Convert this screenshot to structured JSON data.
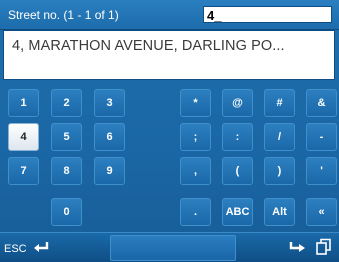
{
  "header": {
    "field_label": "Street no.  (1 - 1 of 1)",
    "input_value": "4_"
  },
  "result": {
    "text": "4, MARATHON AVENUE, DARLING PO..."
  },
  "keys": {
    "k1": "1",
    "k2": "2",
    "k3": "3",
    "k4": "4",
    "k5": "5",
    "k6": "6",
    "k7": "7",
    "k8": "8",
    "k9": "9",
    "k0": "0",
    "asterisk": "*",
    "at": "@",
    "hash": "#",
    "amp": "&",
    "semicolon": ";",
    "colon": ":",
    "slash": "/",
    "dash": "-",
    "comma": ",",
    "lparen": "(",
    "rparen": ")",
    "quote": "'",
    "period": ".",
    "abc": "ABC",
    "alt": "Alt",
    "laquo": "«"
  },
  "footer": {
    "esc_label": "ESC"
  },
  "colors": {
    "background": "#1b67a5",
    "key": "#2c7fc0",
    "selected_key": "#ffffff"
  },
  "selected_key": "4"
}
